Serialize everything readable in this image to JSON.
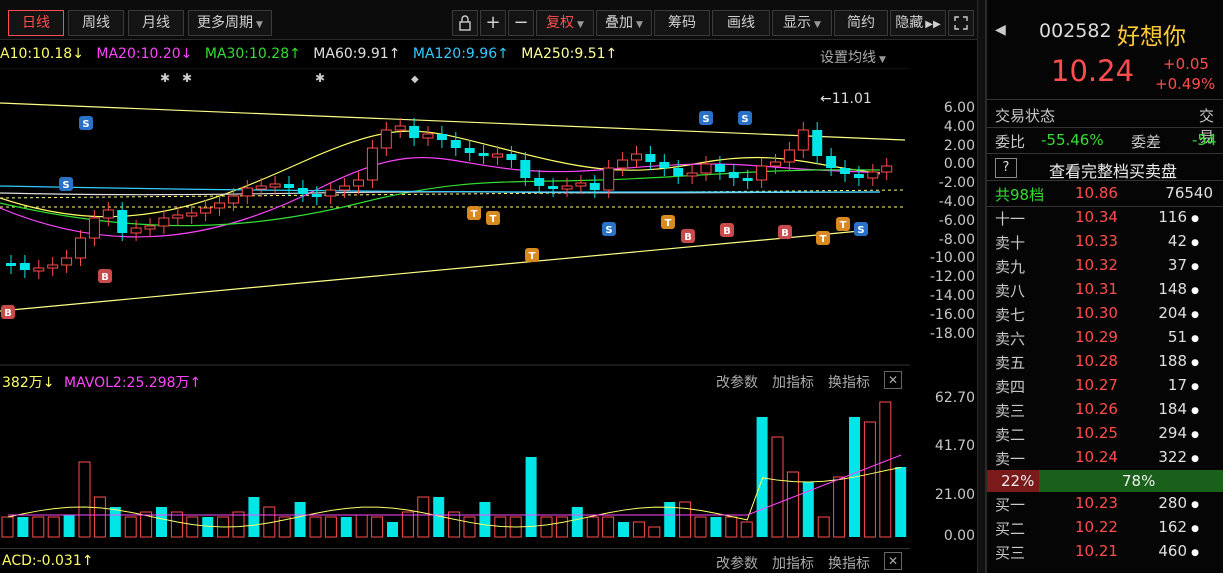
{
  "toolbar": {
    "tabs": [
      "日线",
      "周线",
      "月线",
      "更多周期"
    ],
    "icons": [
      "lock-icon",
      "plus-icon",
      "minus-icon"
    ],
    "right_buttons": [
      "复权",
      "叠加",
      "筹码",
      "画线",
      "显示",
      "简约",
      "隐藏"
    ],
    "active_tab": 0
  },
  "ma": {
    "ma10": "A10:10.18↓",
    "ma20": "MA20:10.20↓",
    "ma30": "MA30:10.28↑",
    "ma60": "MA60:9.91↑",
    "ma120": "MA120:9.96↑",
    "ma250": "MA250:9.51↑",
    "setting": "设置均线"
  },
  "main_axis": [
    "6.00",
    "4.00",
    "2.00",
    "0.00",
    "-2.00",
    "-4.00",
    "-6.00",
    "-8.00",
    "-10.00",
    "-12.00",
    "-14.00",
    "-16.00",
    "-18.00"
  ],
  "peak_label": "11.01",
  "volume": {
    "mavol": "382万↓",
    "mavol2": "MAVOL2:25.298万↑",
    "buttons": [
      "改参数",
      "加指标",
      "换指标"
    ],
    "axis": [
      "62.70",
      "41.70",
      "21.00",
      "0.00"
    ]
  },
  "macd": {
    "label": "ACD:-0.031↑",
    "buttons": [
      "改参数",
      "加指标",
      "换指标"
    ]
  },
  "colors": {
    "up": "#ff4d4d",
    "down": "#00e6e6",
    "bg": "#000000"
  },
  "quote": {
    "code": "002582",
    "name": "好想你",
    "price": "10.24",
    "change": "+0.05",
    "change_pct": "+0.49%",
    "status_label": "交易状态",
    "status_value": "交易",
    "weibi_label": "委比",
    "weibi_value": "-55.46%",
    "weicha_label": "委差",
    "weicha_value": "-54",
    "full_book": "查看完整档买卖盘",
    "total_label": "共98档",
    "total_price": "10.86",
    "total_vol": "76540"
  },
  "asks": [
    {
      "label": "十一",
      "price": "10.34",
      "vol": "116"
    },
    {
      "label": "卖十",
      "price": "10.33",
      "vol": "42"
    },
    {
      "label": "卖九",
      "price": "10.32",
      "vol": "37"
    },
    {
      "label": "卖八",
      "price": "10.31",
      "vol": "148"
    },
    {
      "label": "卖七",
      "price": "10.30",
      "vol": "204"
    },
    {
      "label": "卖六",
      "price": "10.29",
      "vol": "51"
    },
    {
      "label": "卖五",
      "price": "10.28",
      "vol": "188"
    },
    {
      "label": "卖四",
      "price": "10.27",
      "vol": "17"
    },
    {
      "label": "卖三",
      "price": "10.26",
      "vol": "184"
    },
    {
      "label": "卖二",
      "price": "10.25",
      "vol": "294"
    },
    {
      "label": "卖一",
      "price": "10.24",
      "vol": "322"
    }
  ],
  "ratio": {
    "sell": "22%",
    "buy": "78%",
    "sell_frac": 0.22
  },
  "bids": [
    {
      "label": "买一",
      "price": "10.23",
      "vol": "280"
    },
    {
      "label": "买二",
      "price": "10.22",
      "vol": "162"
    },
    {
      "label": "买三",
      "price": "10.21",
      "vol": "460"
    }
  ]
}
